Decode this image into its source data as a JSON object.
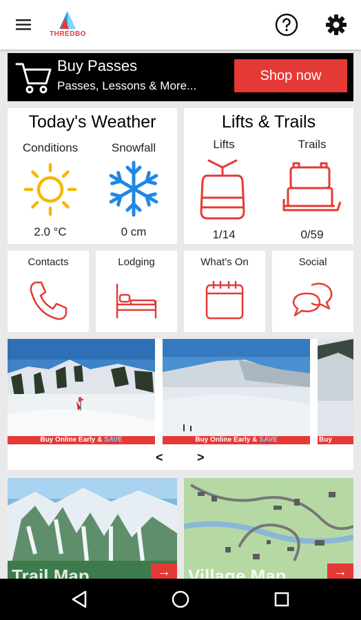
{
  "appbar": {
    "logo_text": "THREDBO",
    "menu_icon": "hamburger-menu-icon",
    "help_icon": "help-circle-icon",
    "settings_icon": "gear-icon"
  },
  "banner": {
    "title": "Buy Passes",
    "subtitle": "Passes, Lessons & More...",
    "button": "Shop now",
    "icon": "cart-icon"
  },
  "weather": {
    "title": "Today's Weather",
    "conditions_label": "Conditions",
    "snowfall_label": "Snowfall",
    "temperature": "2.0 °C",
    "snowfall": "0 cm"
  },
  "lifts": {
    "title": "Lifts & Trails",
    "lifts_label": "Lifts",
    "trails_label": "Trails",
    "lifts_value": "1/14",
    "trails_value": "0/59"
  },
  "tiles": [
    {
      "label": "Contacts",
      "icon": "phone-icon"
    },
    {
      "label": "Lodging",
      "icon": "bed-icon"
    },
    {
      "label": "What's On",
      "icon": "calendar-icon"
    },
    {
      "label": "Social",
      "icon": "chat-bubbles-icon"
    }
  ],
  "webcams": {
    "strip_text": "Buy Online Early & ",
    "strip_save": "SAVE",
    "strip_partial": "Buy",
    "prev": "<",
    "next": ">"
  },
  "maps": [
    {
      "label": "Trail Map"
    },
    {
      "label": "Village Map"
    }
  ],
  "colors": {
    "accent": "#e53935",
    "weather_sun": "#f5b800",
    "weather_snow": "#1e88e5"
  }
}
